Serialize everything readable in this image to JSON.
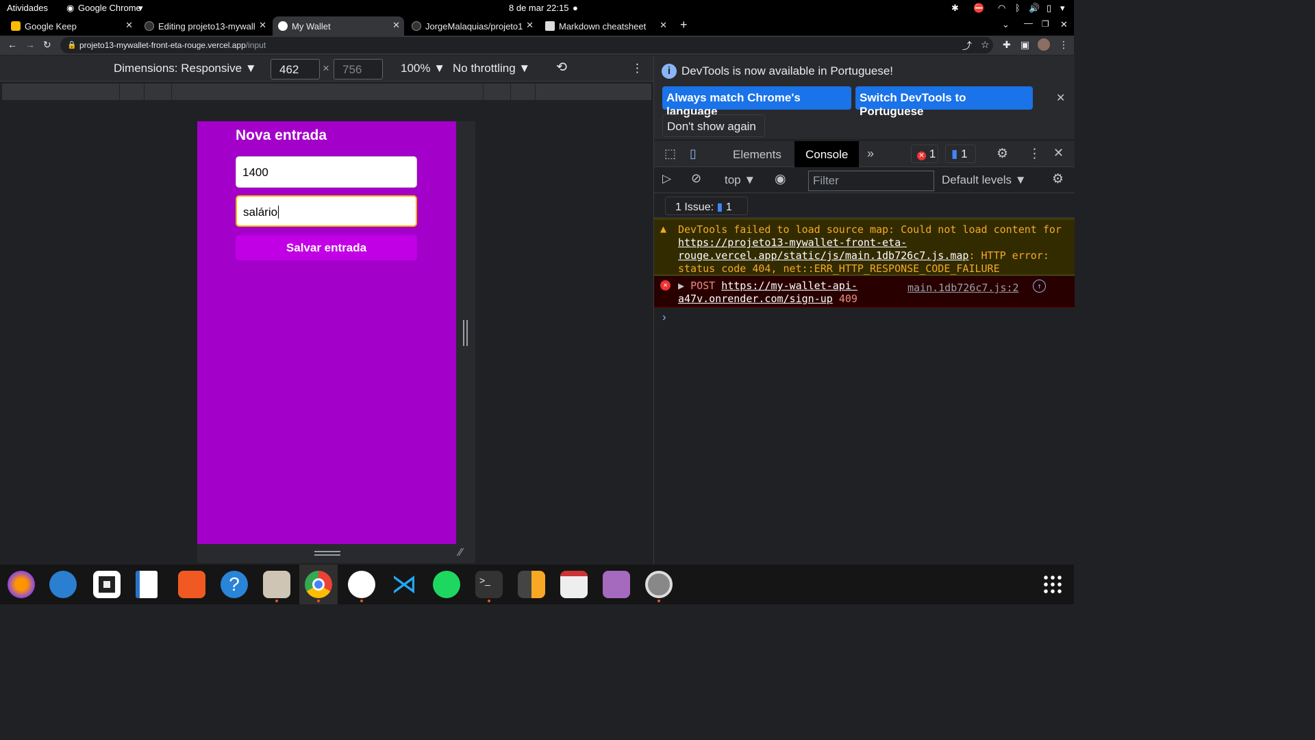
{
  "system_bar": {
    "activities": "Atividades",
    "app_name": "Google Chrome",
    "datetime": "8 de mar  22:15"
  },
  "tabs": [
    {
      "title": "Google Keep",
      "icon": "keep-icon",
      "active": false
    },
    {
      "title": "Editing projeto13-mywall",
      "icon": "github-icon",
      "active": false
    },
    {
      "title": "My Wallet",
      "icon": "globe-icon",
      "active": true
    },
    {
      "title": "JorgeMalaquias/projeto1",
      "icon": "github-icon",
      "active": false
    },
    {
      "title": "Markdown cheatsheet",
      "icon": "document-icon",
      "active": false
    }
  ],
  "address": {
    "host": "projeto13-mywallet-front-eta-rouge.vercel.app",
    "path": "/input"
  },
  "device_toolbar": {
    "dimensions_label": "Dimensions: Responsive",
    "width": "462",
    "height": "756",
    "zoom": "100%",
    "throttling": "No throttling"
  },
  "app": {
    "title": "Nova entrada",
    "amount_value": "1400",
    "description_value": "salário",
    "save_button": "Salvar entrada",
    "background_color": "#a300c9"
  },
  "devtools": {
    "info_message": "DevTools is now available in Portuguese!",
    "always_match_btn": "Always match Chrome's language",
    "switch_btn": "Switch DevTools to Portuguese",
    "dont_show_btn": "Don't show again",
    "tabs": [
      "Elements",
      "Console"
    ],
    "active_tab": "Console",
    "error_count": "1",
    "message_count": "1",
    "context": "top",
    "filter_placeholder": "Filter",
    "levels": "Default levels",
    "issues_label": "1 Issue:",
    "issues_count": "1",
    "warning_prefix": "DevTools failed to load source map: Could not load content for ",
    "warning_link": "https://projeto13-mywallet-front-eta-rouge.vercel.app/static/js/main.1db726c7.js.map",
    "warning_suffix": ": HTTP error: status code 404, net::ERR_HTTP_RESPONSE_CODE_FAILURE",
    "error_method": "POST",
    "error_link": "https://my-wallet-api-a47v.onrender.com/sign-up",
    "error_status": "409",
    "error_source": "main.1db726c7.js:2"
  }
}
